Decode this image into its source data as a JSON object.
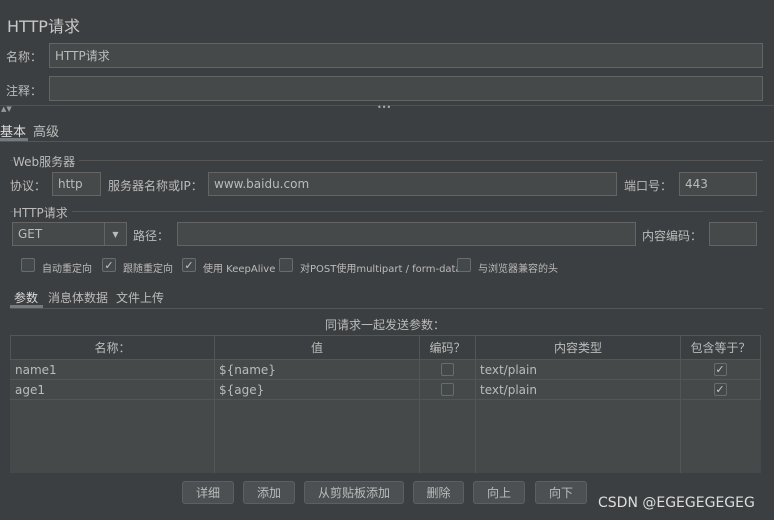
{
  "panel": {
    "title": "HTTP请求"
  },
  "name_row": {
    "label": "名称：",
    "value": "HTTP请求"
  },
  "comment_row": {
    "label": "注释：",
    "value": ""
  },
  "splitter": {
    "arrows": "▲▼",
    "grip": "•••"
  },
  "top_tabs": [
    {
      "label": "基本",
      "active": true
    },
    {
      "label": "高级",
      "active": false
    }
  ],
  "web_server": {
    "group_title": "Web服务器",
    "protocol_label": "协议：",
    "protocol_value": "http",
    "server_label": "服务器名称或IP：",
    "server_value": "www.baidu.com",
    "port_label": "端口号：",
    "port_value": "443"
  },
  "http_request": {
    "group_title": "HTTP请求",
    "method_value": "GET",
    "path_label": "路径：",
    "path_value": "",
    "encoding_label": "内容编码：",
    "encoding_value": ""
  },
  "options": [
    {
      "label": "自动重定向",
      "checked": false
    },
    {
      "label": "跟随重定向",
      "checked": true
    },
    {
      "label": "使用 KeepAlive",
      "checked": true
    },
    {
      "label": "对POST使用multipart / form-data",
      "checked": false
    },
    {
      "label": "与浏览器兼容的头",
      "checked": false
    }
  ],
  "sub_tabs": [
    {
      "label": "参数",
      "active": true
    },
    {
      "label": "消息体数据",
      "active": false
    },
    {
      "label": "文件上传",
      "active": false
    }
  ],
  "params": {
    "caption": "同请求一起发送参数：",
    "columns": [
      "名称：",
      "值",
      "编码？",
      "内容类型",
      "包含等于？"
    ],
    "rows": [
      {
        "name": "name1",
        "value": "${name}",
        "encode": false,
        "content_type": "text/plain",
        "include_equals": true
      },
      {
        "name": "age1",
        "value": "${age}",
        "encode": false,
        "content_type": "text/plain",
        "include_equals": true
      }
    ]
  },
  "buttons": {
    "detail": "详细",
    "add": "添加",
    "add_clipboard": "从剪贴板添加",
    "delete": "删除",
    "up": "向上",
    "down": "向下"
  },
  "watermark": "CSDN @EGEGEGEGEG",
  "icons": {
    "check": "✓",
    "combo_arrow": "▼"
  }
}
